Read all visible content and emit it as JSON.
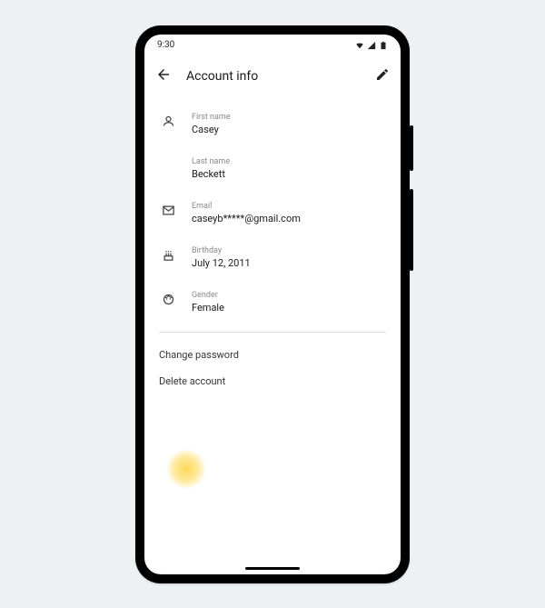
{
  "statusbar": {
    "time": "9:30"
  },
  "appbar": {
    "title": "Account info"
  },
  "fields": {
    "firstName": {
      "label": "First name",
      "value": "Casey"
    },
    "lastName": {
      "label": "Last name",
      "value": "Beckett"
    },
    "email": {
      "label": "Email",
      "value": "caseyb*****@gmail.com"
    },
    "birthday": {
      "label": "Birthday",
      "value": "July 12, 2011"
    },
    "gender": {
      "label": "Gender",
      "value": "Female"
    }
  },
  "actions": {
    "changePassword": "Change password",
    "deleteAccount": "Delete account"
  }
}
